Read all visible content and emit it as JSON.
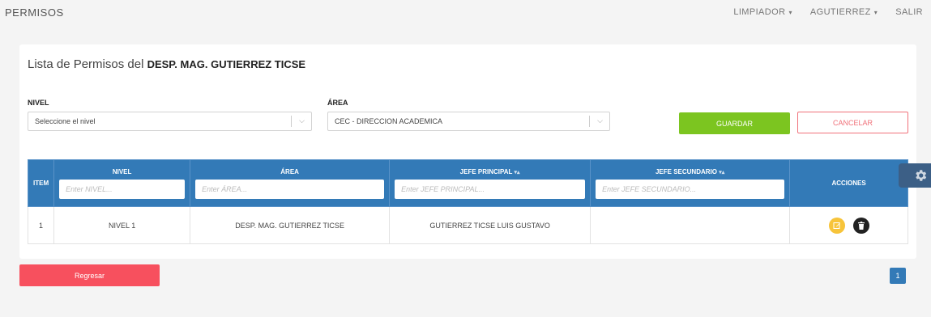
{
  "header": {
    "brand": "PERMISOS",
    "nav": [
      {
        "label": "LIMPIADOR"
      },
      {
        "label": "AGUTIERREZ"
      },
      {
        "label": "SALIR"
      }
    ]
  },
  "card": {
    "title_prefix": "Lista de Permisos del",
    "title_name": "DESP. MAG. GUTIERREZ TICSE"
  },
  "form": {
    "nivel_label": "NIVEL",
    "nivel_value": "Seleccione el nivel",
    "area_label": "ÁREA",
    "area_value": "CEC - DIRECCION ACADEMICA",
    "save_label": "GUARDAR",
    "cancel_label": "CANCELAR"
  },
  "table": {
    "headers": {
      "item": "ITEM",
      "nivel": "NIVEL",
      "area": "ÁREA",
      "jefe_principal": "JEFE PRINCIPAL",
      "jefe_secundario": "JEFE SECUNDARIO",
      "acciones": "ACCIONES"
    },
    "filters": {
      "nivel": "Enter NIVEL...",
      "area": "Enter ÁREA...",
      "jefe_principal": "Enter JEFE PRINCIPAL...",
      "jefe_secundario": "Enter JEFE SECUNDARIO..."
    },
    "rows": [
      {
        "item": "1",
        "nivel": "NIVEL 1",
        "area": "DESP. MAG. GUTIERREZ TICSE",
        "jefe_principal": "GUTIERREZ TICSE LUIS GUSTAVO",
        "jefe_secundario": ""
      }
    ]
  },
  "footer": {
    "back_label": "Regresar",
    "page": "1"
  },
  "colors": {
    "primary": "#337ab7",
    "save": "#7cc520",
    "cancel": "#f0717a",
    "back": "#f7505e",
    "edit": "#f7c43a"
  }
}
